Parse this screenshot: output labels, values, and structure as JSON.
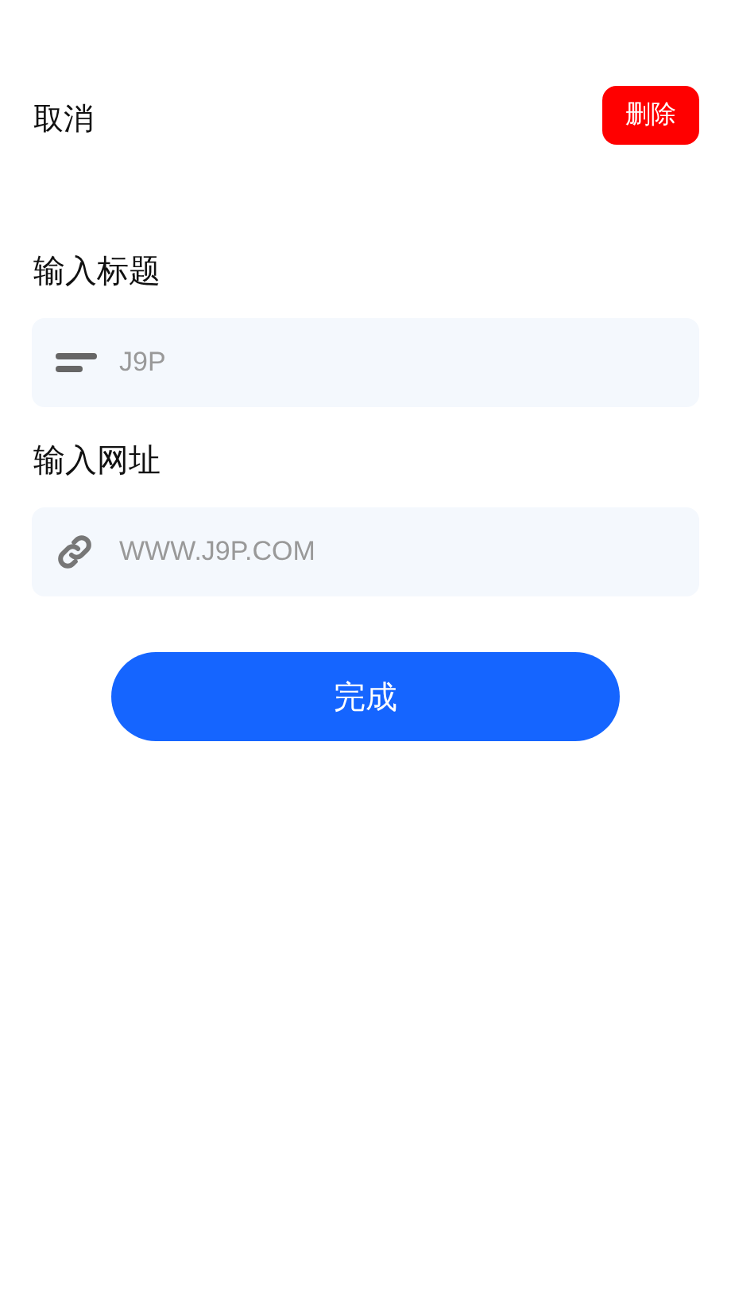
{
  "header": {
    "cancel": "取消",
    "delete": "删除"
  },
  "fields": [
    {
      "kind": "title",
      "label": "输入标题",
      "placeholder": "J9P"
    },
    {
      "kind": "link",
      "label": "输入网址",
      "placeholder": "WWW.J9P.COM"
    }
  ],
  "submit": "完成"
}
